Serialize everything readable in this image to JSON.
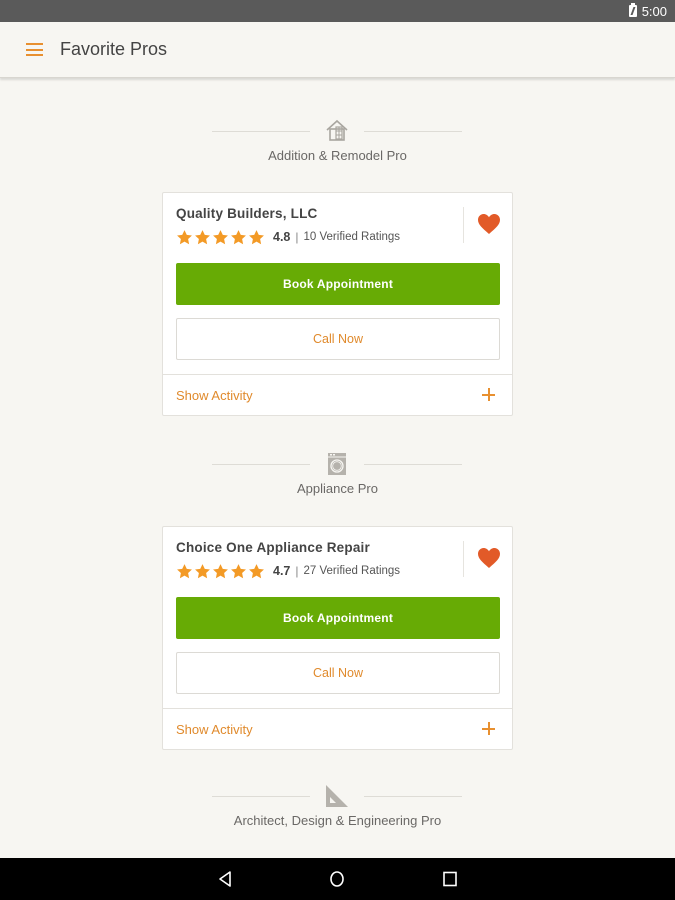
{
  "status_bar": {
    "time": "5:00",
    "battery_icon": "battery-charging-icon"
  },
  "app_bar": {
    "menu_icon": "hamburger-menu-icon",
    "title": "Favorite Pros"
  },
  "sections": [
    {
      "category": "Addition & Remodel Pro",
      "icon": "house-icon",
      "pros": [
        {
          "name": "Quality Builders, LLC",
          "stars": 5,
          "rating": "4.8",
          "separator": "|",
          "ratings_count": "10 Verified Ratings",
          "favorited": true,
          "book_label": "Book Appointment",
          "call_label": "Call Now",
          "activity_label": "Show Activity"
        }
      ]
    },
    {
      "category": "Appliance Pro",
      "icon": "washing-machine-icon",
      "pros": [
        {
          "name": "Choice One Appliance Repair",
          "stars": 5,
          "rating": "4.7",
          "separator": "|",
          "ratings_count": "27 Verified Ratings",
          "favorited": true,
          "book_label": "Book Appointment",
          "call_label": "Call Now",
          "activity_label": "Show Activity"
        }
      ]
    },
    {
      "category": "Architect, Design & Engineering Pro",
      "icon": "set-square-icon",
      "pros": []
    }
  ],
  "colors": {
    "accent_orange": "#e08a2c",
    "star_orange": "#f39a26",
    "heart_red": "#e25a28",
    "book_green": "#67ab05",
    "background": "#f7f6f2"
  },
  "nav_bar": {
    "back": "back-icon",
    "home": "home-icon",
    "recents": "recents-icon"
  }
}
